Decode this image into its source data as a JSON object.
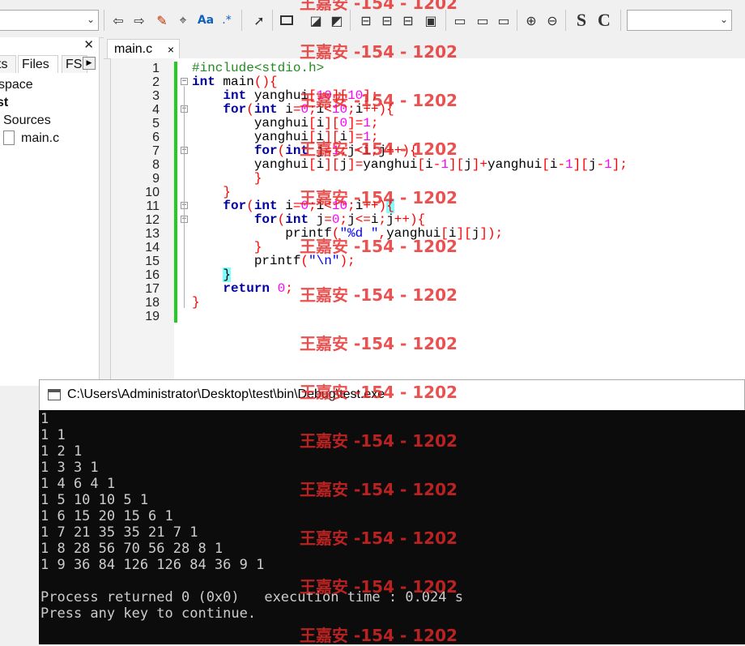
{
  "toolbar": {
    "search_combo_value": "",
    "target_combo_value": ""
  },
  "left_panel": {
    "tabs": [
      "ts",
      "Files",
      "FS"
    ],
    "tree": [
      "space",
      "st",
      "Sources",
      "main.c"
    ]
  },
  "editor": {
    "tab_label": "main.c",
    "close_glyph": "×"
  },
  "code_lines": [
    "#include<stdio.h>",
    "int main(){",
    "    int yanghui[10][10];",
    "    for(int i=0;i<10;i++){",
    "        yanghui[i][0]=1;",
    "        yanghui[i][i]=1;",
    "        for(int j=1;j<i;j++){",
    "        yanghui[i][j]=yanghui[i-1][j]+yanghui[i-1][j-1];",
    "        }",
    "    }",
    "    for(int i=0;i<10;i++){",
    "        for(int j=0;j<=i;j++){",
    "            printf(\"%d \",yanghui[i][j]);",
    "        }",
    "        printf(\"\\n\");",
    "    }",
    "    return 0;",
    "}",
    ""
  ],
  "console": {
    "title": "C:\\Users\\Administrator\\Desktop\\test\\bin\\Debug\\test.exe",
    "lines": [
      "1",
      "1 1",
      "1 2 1",
      "1 3 3 1",
      "1 4 6 4 1",
      "1 5 10 10 5 1",
      "1 6 15 20 15 6 1",
      "1 7 21 35 35 21 7 1",
      "1 8 28 56 70 56 28 8 1",
      "1 9 36 84 126 126 84 36 9 1",
      "",
      "Process returned 0 (0x0)   execution time : 0.024 s",
      "Press any key to continue."
    ]
  },
  "watermark": {
    "text": "王嘉安 -154 - 1202",
    "color": "#e62828"
  },
  "colors": {
    "keyword": "#0000a0",
    "preprocessor": "#228b22",
    "number": "#ff00ff",
    "operator": "#ff0000",
    "change_bar": "#22cc22",
    "console_bg": "#0c0c0c"
  }
}
